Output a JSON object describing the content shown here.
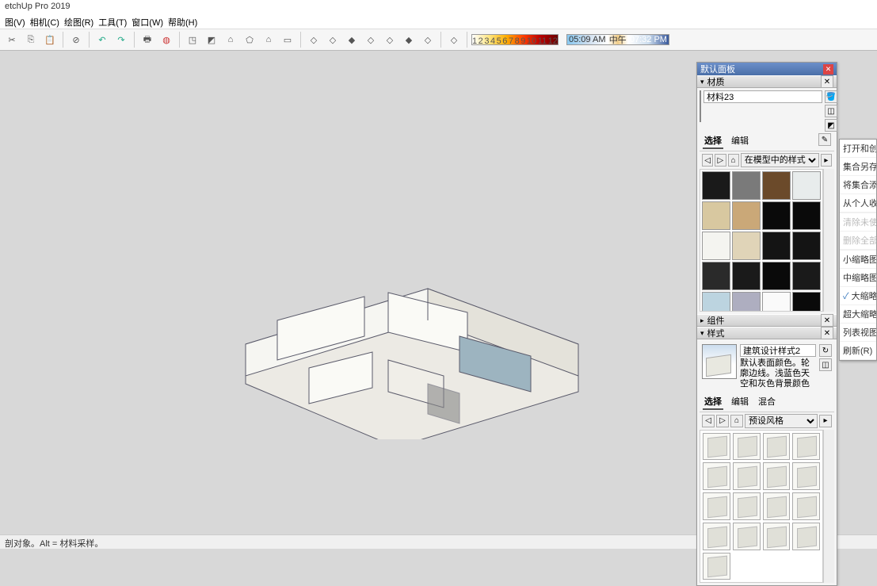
{
  "app": {
    "title": "etchUp Pro 2019"
  },
  "menu": {
    "items": [
      "图(V)",
      "相机(C)",
      "绘图(R)",
      "工具(T)",
      "窗口(W)",
      "帮助(H)"
    ]
  },
  "timebar": {
    "left": "05:09 AM",
    "mid": "中午",
    "right": "07:32 PM"
  },
  "status": {
    "text": "剖对象。Alt = 材料采样。"
  },
  "panel": {
    "title": "默认面板",
    "materials": {
      "label": "材质",
      "current_name": "材料23",
      "tab_select": "选择",
      "tab_edit": "编辑",
      "dropdown": "在模型中的样式",
      "swatches": [
        "#1a1a1a",
        "#7a7a7a",
        "#6b4a2a",
        "#e8ecec",
        "#d8c8a0",
        "#caa878",
        "#0a0a0a",
        "#0a0a0a",
        "#f4f4f0",
        "#e0d4b8",
        "#141414",
        "#141414",
        "#2a2a2a",
        "#1a1a1a",
        "#0a0a0a",
        "#1a1a1a",
        "#bcd4e0",
        "#aeaec0",
        "#fafafa",
        "#0a0a0a"
      ]
    },
    "components": {
      "label": "组件"
    },
    "styles": {
      "label": "样式",
      "name": "建筑设计样式2",
      "desc": "默认表面颜色。轮廓边线。浅蓝色天空和灰色背景颜色",
      "tab_select": "选择",
      "tab_edit": "编辑",
      "tab_mix": "混合",
      "dropdown": "预设风格"
    }
  },
  "context": {
    "items": [
      {
        "t": "打开和创建",
        "d": false
      },
      {
        "t": "集合另存为",
        "d": false
      },
      {
        "t": "将集合添加",
        "d": false
      },
      {
        "t": "从个人收藏",
        "d": false
      },
      {
        "sep": true
      },
      {
        "t": "清除未使用",
        "d": true
      },
      {
        "t": "删除全部(",
        "d": true
      },
      {
        "sep": true
      },
      {
        "t": "小缩略图",
        "d": false
      },
      {
        "t": "中缩略图",
        "d": false
      },
      {
        "t": "大缩略图",
        "d": false,
        "c": true
      },
      {
        "t": "超大缩略图",
        "d": false
      },
      {
        "t": "列表视图",
        "d": false
      },
      {
        "t": "刷新(R)",
        "d": false
      }
    ]
  }
}
